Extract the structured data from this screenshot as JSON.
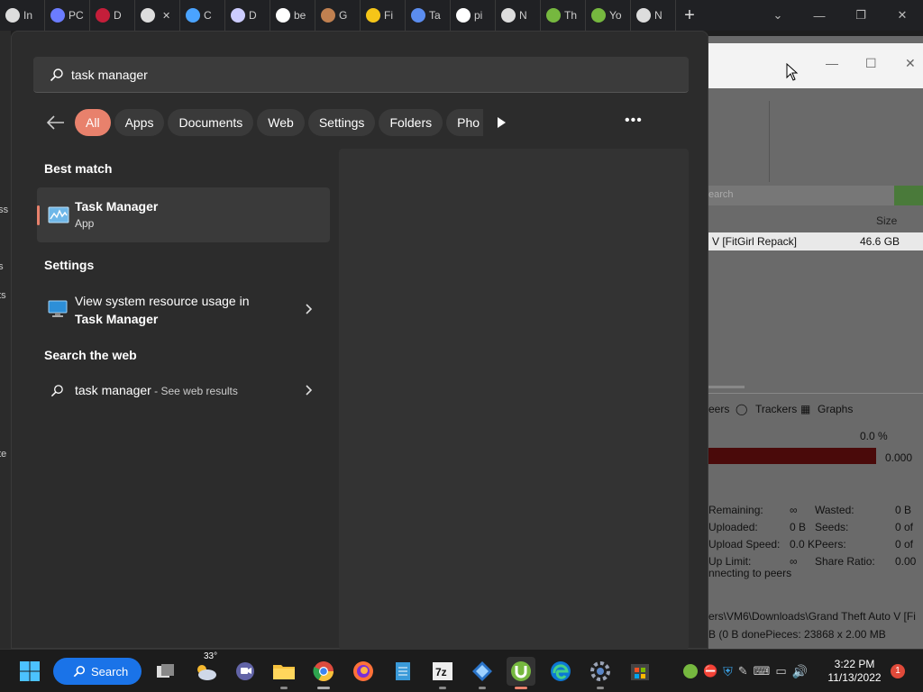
{
  "browser_tabs": [
    {
      "icon": "bank-icon",
      "text": "In",
      "color": "#dddddd"
    },
    {
      "icon": "diamond-icon",
      "text": "PC",
      "color": "#6b7cff"
    },
    {
      "icon": "shield-v-icon",
      "text": "D",
      "color": "#c41e3a"
    },
    {
      "icon": "download-icon",
      "text": "",
      "color": "#dddddd"
    },
    {
      "icon": "target-icon",
      "text": "C",
      "color": "#4aa3ff"
    },
    {
      "icon": "disc-icon",
      "text": "D",
      "color": "#ccccff"
    },
    {
      "icon": "google-icon",
      "text": "be",
      "color": "#ffffff"
    },
    {
      "icon": "avatar-icon",
      "text": "G",
      "color": "#c08050"
    },
    {
      "icon": "hex-icon",
      "text": "Fi",
      "color": "#f5c518"
    },
    {
      "icon": "gear-icon",
      "text": "Ta",
      "color": "#5b8def"
    },
    {
      "icon": "google-icon",
      "text": "pi",
      "color": "#ffffff"
    },
    {
      "icon": "chrome-icon",
      "text": "N",
      "color": "#dddddd"
    },
    {
      "icon": "utorrent-icon",
      "text": "Th",
      "color": "#76b83f"
    },
    {
      "icon": "utorrent-icon",
      "text": "Yo",
      "color": "#76b83f"
    },
    {
      "icon": "chrome-icon",
      "text": "N",
      "color": "#dddddd"
    }
  ],
  "search": {
    "query": "task manager"
  },
  "filters": [
    "All",
    "Apps",
    "Documents",
    "Web",
    "Settings",
    "Folders",
    "Pho"
  ],
  "sections": {
    "best_match": "Best match",
    "settings": "Settings",
    "web": "Search the web"
  },
  "best_match": {
    "name": "Task Manager",
    "type": "App"
  },
  "settings_item": {
    "line1": "View system resource usage in",
    "line2": "Task Manager"
  },
  "web_item": {
    "query": "task manager",
    "suffix": " - See web results"
  },
  "background_window": {
    "search_placeholder": "earch",
    "size_header": "Size",
    "row_name": "V [FitGirl Repack]",
    "row_size": "46.6 GB",
    "tab_peers": "eers",
    "tab_trackers": "Trackers",
    "tab_graphs": "Graphs",
    "pct": "0.0 %",
    "bar_value": "0.000",
    "stats": [
      {
        "label": "Remaining:",
        "value": "∞"
      },
      {
        "label": "Uploaded:",
        "value": "0 B"
      },
      {
        "label": "Upload Speed:",
        "value": "0.0 K"
      },
      {
        "label": "Up Limit:",
        "value": "∞"
      }
    ],
    "stats2": [
      {
        "label": "Wasted:",
        "value": "0 B"
      },
      {
        "label": "Seeds:",
        "value": "0 of"
      },
      {
        "label": "Peers:",
        "value": "0 of"
      },
      {
        "label": "Share Ratio:",
        "value": "0.00"
      }
    ],
    "status": "nnecting to peers",
    "path": "ers\\VM6\\Downloads\\Grand Theft Auto V [Fi",
    "path2": "B (0 B donePieces:        23868 x 2.00 MB"
  },
  "left_sliver": [
    "ess",
    "ds",
    "nts",
    "ute"
  ],
  "taskbar": {
    "search_label": "Search",
    "weather_temp": "33°",
    "time": "3:22 PM",
    "date": "11/13/2022",
    "notifications": "1"
  }
}
